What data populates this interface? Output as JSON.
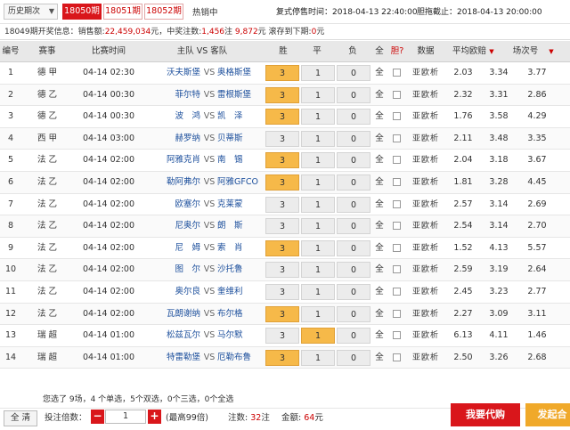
{
  "top": {
    "period_select": "历史期次",
    "tabs": [
      "18050期",
      "18051期",
      "18052期"
    ],
    "hot": "热销中",
    "resume_label": "复式停售时间：",
    "resume_time": "2018-04-13 22:40:00",
    "single_label": "胆拖截止：",
    "single_time": "2018-04-13 20:00:00"
  },
  "info": {
    "p1": "18049期开奖信息：",
    "p2": "销售额:",
    "sales": "22,459,034",
    "p3": "元，中奖注数:",
    "count": "1,456",
    "p4": "注 ",
    "prize": "9,872",
    "p5": "元 滚存到下期:",
    "rollover": "0",
    "p6": "元"
  },
  "headers": {
    "no": "编号",
    "league": "赛事",
    "time": "比赛时间",
    "home": "主队",
    "vs": "VS",
    "away": "客队",
    "win": "胜",
    "draw": "平",
    "lose": "负",
    "all": "全",
    "dan": "胆?",
    "data": "数据",
    "avg": "平均欧赔",
    "odds": "场次号"
  },
  "matches": [
    {
      "no": "1",
      "league": "德 甲",
      "time": "04-14 02:30",
      "home": "沃夫斯堡",
      "away": "奥格斯堡",
      "win": "3",
      "draw": "1",
      "lose": "0",
      "sel": "3",
      "links": "亚欧析",
      "o1": "2.03",
      "o2": "3.34",
      "o3": "3.77"
    },
    {
      "no": "2",
      "league": "德 乙",
      "time": "04-14 00:30",
      "home": "菲尔特",
      "away": "雷根斯堡",
      "win": "3",
      "draw": "1",
      "lose": "0",
      "sel": "3",
      "links": "亚欧析",
      "o1": "2.32",
      "o2": "3.31",
      "o3": "2.86"
    },
    {
      "no": "3",
      "league": "德 乙",
      "time": "04-14 00:30",
      "home": "波　鸿",
      "away": "凯　泽",
      "win": "3",
      "draw": "1",
      "lose": "0",
      "sel": "3",
      "links": "亚欧析",
      "o1": "1.76",
      "o2": "3.58",
      "o3": "4.29"
    },
    {
      "no": "4",
      "league": "西 甲",
      "time": "04-14 03:00",
      "home": "赫罗纳",
      "away": "贝蒂斯",
      "win": "3",
      "draw": "1",
      "lose": "0",
      "sel": "",
      "links": "亚欧析",
      "o1": "2.11",
      "o2": "3.48",
      "o3": "3.35"
    },
    {
      "no": "5",
      "league": "法 乙",
      "time": "04-14 02:00",
      "home": "阿雅克肖",
      "away": "南　锡",
      "win": "3",
      "draw": "1",
      "lose": "0",
      "sel": "3",
      "links": "亚欧析",
      "o1": "2.04",
      "o2": "3.18",
      "o3": "3.67"
    },
    {
      "no": "6",
      "league": "法 乙",
      "time": "04-14 02:00",
      "home": "勒阿弗尔",
      "away": "阿雅GFCO",
      "win": "3",
      "draw": "1",
      "lose": "0",
      "sel": "3",
      "links": "亚欧析",
      "o1": "1.81",
      "o2": "3.28",
      "o3": "4.45"
    },
    {
      "no": "7",
      "league": "法 乙",
      "time": "04-14 02:00",
      "home": "欧塞尔",
      "away": "克莱蒙",
      "win": "3",
      "draw": "1",
      "lose": "0",
      "sel": "",
      "links": "亚欧析",
      "o1": "2.57",
      "o2": "3.14",
      "o3": "2.69"
    },
    {
      "no": "8",
      "league": "法 乙",
      "time": "04-14 02:00",
      "home": "尼奥尔",
      "away": "朗　斯",
      "win": "3",
      "draw": "1",
      "lose": "0",
      "sel": "",
      "links": "亚欧析",
      "o1": "2.54",
      "o2": "3.14",
      "o3": "2.70"
    },
    {
      "no": "9",
      "league": "法 乙",
      "time": "04-14 02:00",
      "home": "尼　姆",
      "away": "索　肖",
      "win": "3",
      "draw": "1",
      "lose": "0",
      "sel": "3",
      "links": "亚欧析",
      "o1": "1.52",
      "o2": "4.13",
      "o3": "5.57"
    },
    {
      "no": "10",
      "league": "法 乙",
      "time": "04-14 02:00",
      "home": "图　尔",
      "away": "沙托鲁",
      "win": "3",
      "draw": "1",
      "lose": "0",
      "sel": "",
      "links": "亚欧析",
      "o1": "2.59",
      "o2": "3.19",
      "o3": "2.64"
    },
    {
      "no": "11",
      "league": "法 乙",
      "time": "04-14 02:00",
      "home": "奥尔良",
      "away": "奎维利",
      "win": "3",
      "draw": "1",
      "lose": "0",
      "sel": "",
      "links": "亚欧析",
      "o1": "2.45",
      "o2": "3.23",
      "o3": "2.77"
    },
    {
      "no": "12",
      "league": "法 乙",
      "time": "04-14 02:00",
      "home": "瓦朗谢纳",
      "away": "布尔格",
      "win": "3",
      "draw": "1",
      "lose": "0",
      "sel": "3",
      "links": "亚欧析",
      "o1": "2.27",
      "o2": "3.09",
      "o3": "3.11"
    },
    {
      "no": "13",
      "league": "瑞 超",
      "time": "04-14 01:00",
      "home": "松兹瓦尔",
      "away": "马尔默",
      "win": "3",
      "draw": "1",
      "lose": "0",
      "sel": "1",
      "links": "亚欧析",
      "o1": "6.13",
      "o2": "4.11",
      "o3": "1.46"
    },
    {
      "no": "14",
      "league": "瑞 超",
      "time": "04-14 01:00",
      "home": "特雷勒堡",
      "away": "厄勒布鲁",
      "win": "3",
      "draw": "1",
      "lose": "0",
      "sel": "3",
      "links": "亚欧析",
      "o1": "2.50",
      "o2": "3.26",
      "o3": "2.68"
    }
  ],
  "footer": {
    "summary": "您选了 9场，4 个单选，5个双选，0个三选，0个全选",
    "clear": "全 清",
    "mult_label": "投注倍数：",
    "minus": "−",
    "qty": "1",
    "plus": "+",
    "max": "(最高99倍)",
    "bets_label": "注数:",
    "bets": "32",
    "bets_unit": "注",
    "amount_label": "金额:",
    "amount": "64",
    "amount_unit": "元",
    "buy": "我要代购",
    "launch": "发起合"
  },
  "colors": {
    "accent": "#d9161b",
    "pick": "#f6b949"
  }
}
